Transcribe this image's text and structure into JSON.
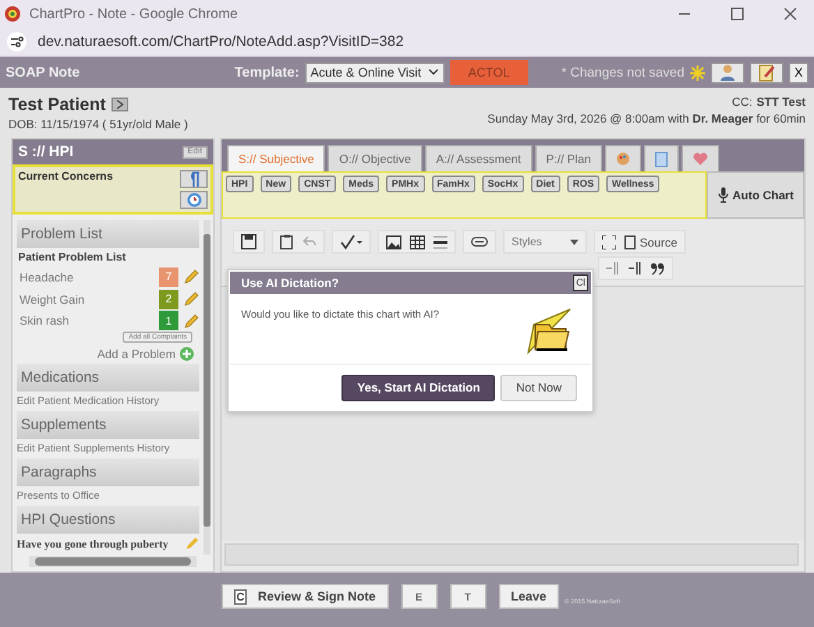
{
  "browser": {
    "title": "ChartPro - Note - Google Chrome",
    "url": "dev.naturaesoft.com/ChartPro/NoteAdd.asp?VisitID=382"
  },
  "header": {
    "title": "SOAP Note",
    "template_label": "Template:",
    "template_value": "Acute & Online Visit",
    "badge": "ACTOL",
    "unsaved": "* Changes not saved",
    "close": "X"
  },
  "patient": {
    "name": "Test Patient",
    "dob": "DOB: 11/15/1974 ( 51yr/old Male )",
    "cc_label": "CC:",
    "cc": "STT Test",
    "visit": "Sunday May 3rd, 2026 @ 8:00am with **Dr. Meager** for 60min"
  },
  "hpi": {
    "title": "S :// HPI",
    "edit": "Edit",
    "concerns": "Current Concerns"
  },
  "problem_list": {
    "title": "Problem List",
    "subtitle": "Patient Problem List",
    "add_all": "Add all Complaints",
    "add": "Add a Problem"
  },
  "problems": [
    {
      "name": "Headache",
      "count": "7",
      "color": "#e8956f"
    },
    {
      "name": "Weight Gain",
      "count": "2",
      "color": "#7d9a1e"
    },
    {
      "name": "Skin rash",
      "count": "1",
      "color": "#2f9a3a"
    }
  ],
  "sections": [
    {
      "title": "Medications",
      "link": "Edit Patient Medication History"
    },
    {
      "title": "Supplements",
      "link": "Edit Patient Supplements History"
    },
    {
      "title": "Paragraphs",
      "link": "Presents to Office"
    },
    {
      "title": "HPI Questions",
      "link": "Have you gone through puberty"
    }
  ],
  "tabs": [
    {
      "kind": "text",
      "label": "S:// Subjective",
      "selected": true
    },
    {
      "kind": "text",
      "label": "O:// Objective",
      "selected": false
    },
    {
      "kind": "text",
      "label": "A:// Assessment",
      "selected": false
    },
    {
      "kind": "text",
      "label": "P:// Plan",
      "selected": false
    },
    {
      "kind": "palette",
      "selected": false
    },
    {
      "kind": "page",
      "selected": false
    },
    {
      "kind": "heart",
      "selected": false
    }
  ],
  "chips": [
    "HPI",
    "New",
    "CNST",
    "Meds",
    "PMHx",
    "FamHx",
    "SocHx",
    "Diet",
    "ROS",
    "Wellness"
  ],
  "auto_chart": "Auto Chart",
  "toolbar": {
    "styles": "Styles",
    "source": "Source"
  },
  "dialog": {
    "title": "Use AI Dictation?",
    "close": "Cl",
    "message": "Would you like to dictate this chart with AI?",
    "primary": "Yes, Start AI Dictation",
    "secondary": "Not Now"
  },
  "footer": {
    "buttons": [
      {
        "kind": "keyed",
        "key": "C",
        "label": "Review & Sign Note"
      },
      {
        "kind": "key",
        "key": "E"
      },
      {
        "kind": "key",
        "key": "T"
      },
      {
        "kind": "plain",
        "label": "Leave"
      }
    ],
    "copyright": "© 2015 NaturaeSoft"
  }
}
